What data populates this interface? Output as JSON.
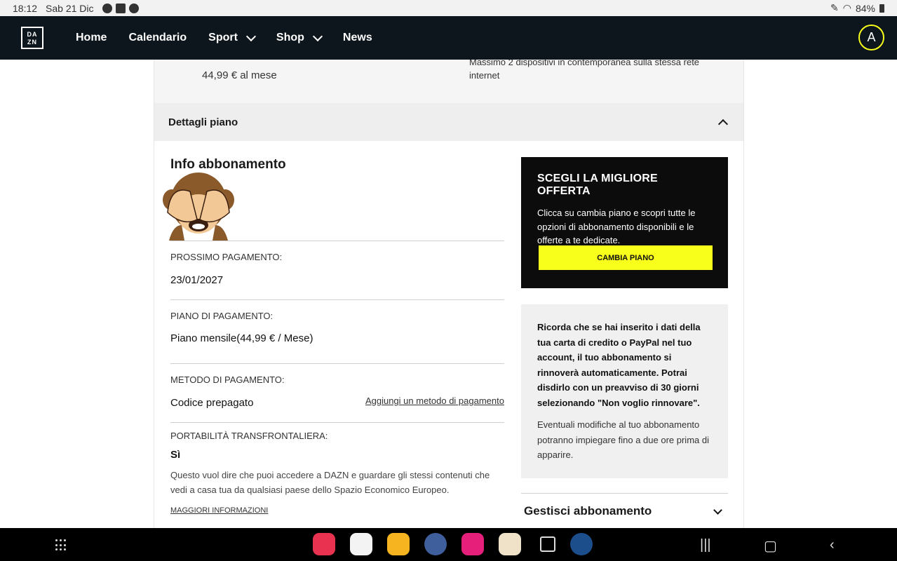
{
  "status_bar": {
    "time": "18:12",
    "date": "Sab 21 Dic",
    "battery": "84%"
  },
  "nav": {
    "logo_text": "DA ZN",
    "items": [
      "Home",
      "Calendario",
      "Sport",
      "Shop",
      "News"
    ],
    "avatar_letter": "A"
  },
  "plan": {
    "price": "44,99 € al mese",
    "devices": "Massimo 2 dispositivi in contemporanea sulla stessa rete internet"
  },
  "details": {
    "title": "Dettagli piano"
  },
  "info": {
    "heading": "Info abbonamento",
    "next_payment_label": "PROSSIMO PAGAMENTO:",
    "next_payment_value": "23/01/2027",
    "plan_label": "PIANO DI PAGAMENTO:",
    "plan_value": "Piano mensile(44,99 € / Mese)",
    "method_label": "METODO DI PAGAMENTO:",
    "method_value": "Codice prepagato",
    "add_method_link": "Aggiungi un metodo di pagamento",
    "portability_label": "PORTABILITÀ TRANSFRONTALIERA:",
    "portability_value": "Sì",
    "portability_desc": "Questo vuol dire che puoi accedere a DAZN e guardare gli stessi contenuti che vedi a casa tua da qualsiasi paese dello Spazio Economico Europeo.",
    "more_info": "MAGGIORI INFORMAZIONI"
  },
  "offer": {
    "title": "SCEGLI LA MIGLIORE OFFERTA",
    "desc": "Clicca su cambia piano e scopri tutte le opzioni di abbonamento disponibili e le offerte a te dedicate.",
    "button": "CAMBIA PIANO"
  },
  "notice": {
    "bold_text": "Ricorda che se hai inserito i dati della tua carta di credito o PayPal nel tuo account, il tuo abbonamento si rinnoverà automaticamente. Potrai disdirlo con un preavviso di 30 giorni selezionando \"Non voglio rinnovare\".",
    "text": "Eventuali modifiche al tuo abbonamento potranno impiegare fino a due ore prima di apparire."
  },
  "manage": {
    "title": "Gestisci abbonamento"
  },
  "colors": {
    "accent": "#f7ff1a",
    "nav_bg": "#0c161c"
  }
}
